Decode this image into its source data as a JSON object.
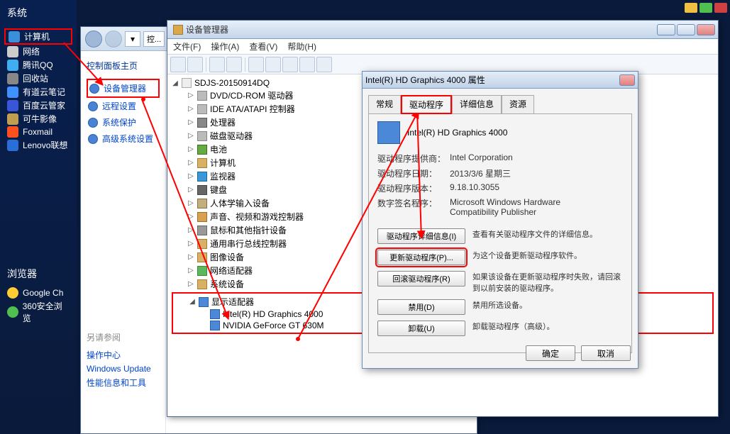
{
  "desktop": {
    "sys_title": "系统",
    "items": [
      "计算机",
      "网络",
      "腾讯QQ",
      "回收站",
      "有道云笔记",
      "百度云管家",
      "可牛影像",
      "Foxmail",
      "Lenovo联想"
    ],
    "browser_title": "浏览器",
    "browsers": [
      "Google Ch",
      "360安全浏览"
    ]
  },
  "cp": {
    "crumb": "控...",
    "side_title": "控制面板主页",
    "items": [
      "设备管理器",
      "远程设置",
      "系统保护",
      "高级系统设置"
    ],
    "also_title": "另请参阅",
    "also_items": [
      "操作中心",
      "Windows Update",
      "性能信息和工具"
    ]
  },
  "dm": {
    "title": "设备管理器",
    "menus": [
      "文件(F)",
      "操作(A)",
      "查看(V)",
      "帮助(H)"
    ],
    "root": "SDJS-20150914DQ",
    "nodes": [
      "DVD/CD-ROM 驱动器",
      "IDE ATA/ATAPI 控制器",
      "处理器",
      "磁盘驱动器",
      "电池",
      "计算机",
      "监视器",
      "键盘",
      "人体学输入设备",
      "声音、视频和游戏控制器",
      "鼠标和其他指针设备",
      "通用串行总线控制器",
      "图像设备",
      "网络适配器",
      "系统设备"
    ],
    "display_node": "显示适配器",
    "display_children": [
      "Intel(R) HD Graphics 4000",
      "NVIDIA GeForce GT 630M"
    ]
  },
  "prop": {
    "title": "Intel(R) HD Graphics 4000 属性",
    "tabs": [
      "常规",
      "驱动程序",
      "详细信息",
      "资源"
    ],
    "device": "Intel(R) HD Graphics 4000",
    "labels": {
      "provider": "驱动程序提供商：",
      "date": "驱动程序日期：",
      "version": "驱动程序版本：",
      "signer": "数字签名程序："
    },
    "values": {
      "provider": "Intel Corporation",
      "date": "2013/3/6 星期三",
      "version": "9.18.10.3055",
      "signer": "Microsoft Windows Hardware Compatibility Publisher"
    },
    "buttons": {
      "details": "驱动程序详细信息(I)",
      "update": "更新驱动程序(P)...",
      "rollback": "回滚驱动程序(R)",
      "disable": "禁用(D)",
      "uninstall": "卸载(U)"
    },
    "descs": {
      "details": "查看有关驱动程序文件的详细信息。",
      "update": "为这个设备更新驱动程序软件。",
      "rollback": "如果该设备在更新驱动程序时失败，请回滚到以前安装的驱动程序。",
      "disable": "禁用所选设备。",
      "uninstall": "卸载驱动程序（高级）。"
    },
    "ok": "确定",
    "cancel": "取消"
  }
}
